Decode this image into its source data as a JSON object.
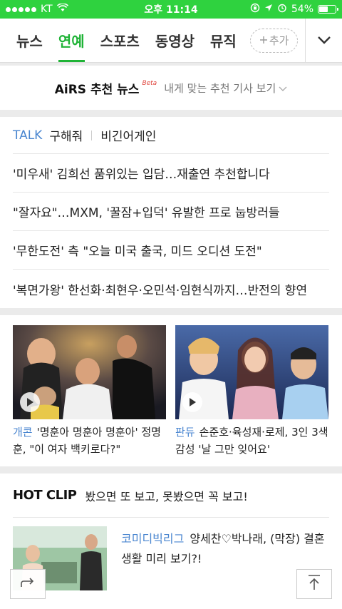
{
  "status_bar": {
    "carrier": "KT",
    "time": "오후 11:14",
    "battery": "54%",
    "battery_level": 0.54
  },
  "tabs": [
    {
      "label": "뉴스",
      "active": false
    },
    {
      "label": "연예",
      "active": true
    },
    {
      "label": "스포츠",
      "active": false
    },
    {
      "label": "동영상",
      "active": false
    },
    {
      "label": "뮤직",
      "active": false
    }
  ],
  "tab_add_label": "추가",
  "colors": {
    "brand_green": "#2fd23f",
    "accent_green": "#1fb336",
    "link_blue": "#4a86d0"
  },
  "airs": {
    "brand": "AiRS 추천 뉴스",
    "beta": "Beta",
    "subtitle": "내게 맞는 추천 기사 보기"
  },
  "talk": {
    "label": "TALK",
    "keywords": [
      "구해줘",
      "비긴어게인"
    ],
    "headlines": [
      "'미우새' 김희선 품위있는 입담…재출연 추천합니다",
      "\"잘자요\"…MXM, '꿀잠+입덕' 유발한 프로 눕방러들",
      "'무한도전' 측 \"오늘 미국 출국, 미드 오디션 도전\"",
      "'복면가왕' 한선화·최현우·오민석·임현식까지…반전의 향연"
    ]
  },
  "videos": [
    {
      "category": "개콘",
      "title": "'명훈아 명훈아 명훈아' 정명훈, \"이 여자 백키로다?\""
    },
    {
      "category": "판듀",
      "title": "손준호·육성재·로제, 3인 3색 감성 '날 그만 잊어요'"
    }
  ],
  "hot_clip": {
    "title": "HOT CLIP",
    "subtitle": "봤으면 또 보고, 못봤으면 꼭 보고!",
    "items": [
      {
        "category": "코미디빅리그",
        "title": "양세찬♡박나래, (막장) 결혼생활 미리 보기?!"
      }
    ]
  }
}
